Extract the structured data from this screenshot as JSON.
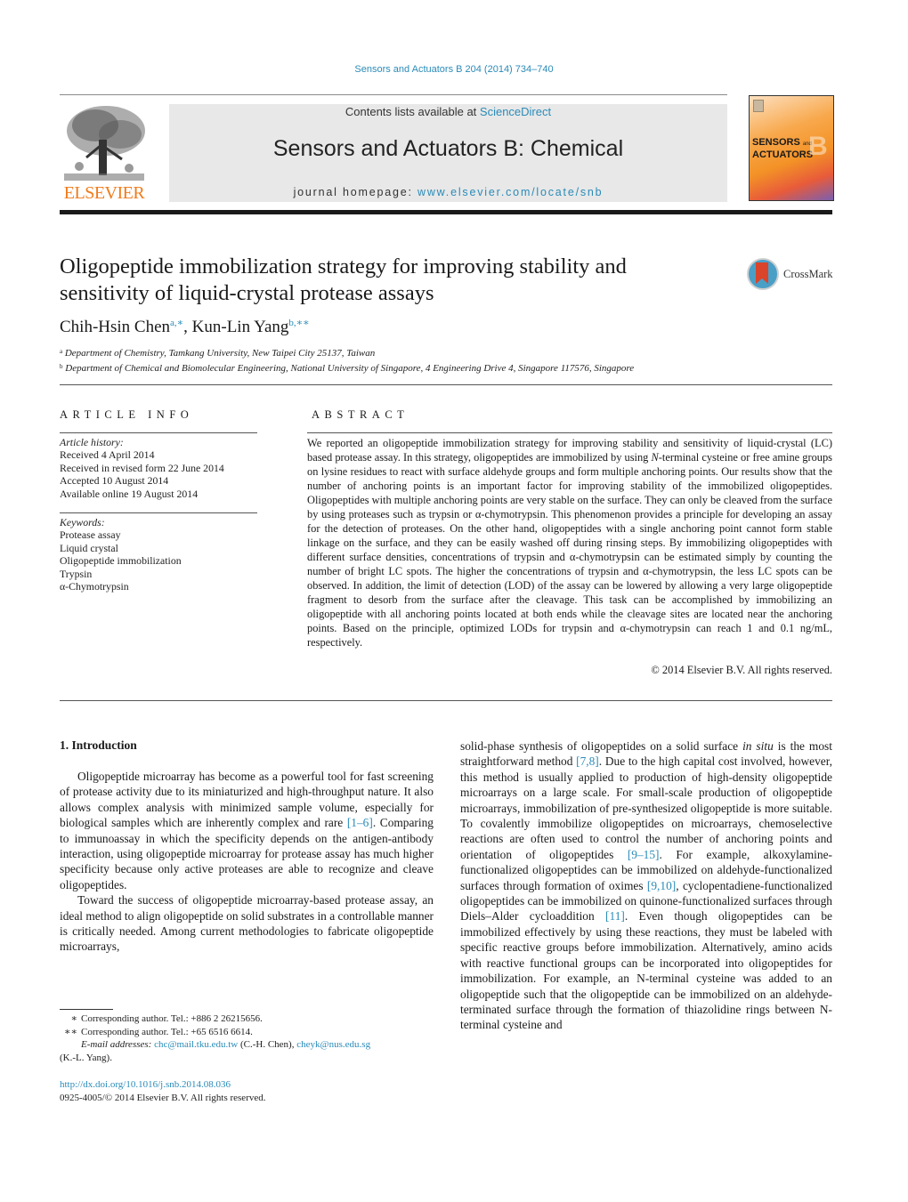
{
  "header": {
    "journal_ref": "Sensors and Actuators B 204 (2014) 734–740",
    "contents_prefix": "Contents lists available at ",
    "contents_link": "ScienceDirect",
    "journal_title": "Sensors and Actuators B: Chemical",
    "homepage_prefix": "journal homepage: ",
    "homepage_link": "www.elsevier.com/locate/snb",
    "publisher_logo_text": "ELSEVIER",
    "cover": {
      "title_line1": "SENSORS",
      "title_and": "and",
      "title_line2": "ACTUATORS",
      "letter": "B"
    },
    "colors": {
      "link": "#2a8bb8",
      "elsevier_orange": "#f07b1a"
    }
  },
  "article": {
    "title": "Oligopeptide immobilization strategy for improving stability and sensitivity of liquid-crystal protease assays",
    "crossmark_label": "CrossMark",
    "authors": [
      {
        "name": "Chih-Hsin Chen",
        "sup": "a,∗"
      },
      {
        "name": "Kun-Lin Yang",
        "sup": "b,∗∗"
      }
    ],
    "author_separator": ", ",
    "affiliations": [
      {
        "mark": "a",
        "text": "Department of Chemistry, Tamkang University, New Taipei City 25137, Taiwan"
      },
      {
        "mark": "b",
        "text": "Department of Chemical and Biomolecular Engineering, National University of Singapore, 4 Engineering Drive 4, Singapore 117576, Singapore"
      }
    ]
  },
  "article_info": {
    "heading": "ARTICLE INFO",
    "history_label": "Article history:",
    "history": [
      "Received 4 April 2014",
      "Received in revised form 22 June 2014",
      "Accepted 10 August 2014",
      "Available online 19 August 2014"
    ],
    "keywords_label": "Keywords:",
    "keywords": [
      "Protease assay",
      "Liquid crystal",
      "Oligopeptide immobilization",
      "Trypsin",
      "α-Chymotrypsin"
    ]
  },
  "abstract": {
    "heading": "ABSTRACT",
    "text_part1": "We reported an oligopeptide immobilization strategy for improving stability and sensitivity of liquid-crystal (LC) based protease assay. In this strategy, oligopeptides are immobilized by using ",
    "text_italic": "N",
    "text_part2": "-terminal cysteine or free amine groups on lysine residues to react with surface aldehyde groups and form multiple anchoring points. Our results show that the number of anchoring points is an important factor for improving stability of the immobilized oligopeptides. Oligopeptides with multiple anchoring points are very stable on the surface. They can only be cleaved from the surface by using proteases such as trypsin or α-chymotrypsin. This phenomenon provides a principle for developing an assay for the detection of proteases. On the other hand, oligopeptides with a single anchoring point cannot form stable linkage on the surface, and they can be easily washed off during rinsing steps. By immobilizing oligopeptides with different surface densities, concentrations of trypsin and α-chymotrypsin can be estimated simply by counting the number of bright LC spots. The higher the concentrations of trypsin and α-chymotrypsin, the less LC spots can be observed. In addition, the limit of detection (LOD) of the assay can be lowered by allowing a very large oligopeptide fragment to desorb from the surface after the cleavage. This task can be accomplished by immobilizing an oligopeptide with all anchoring points located at both ends while the cleavage sites are located near the anchoring points. Based on the principle, optimized LODs for trypsin and α-chymotrypsin can reach 1 and 0.1 ng/mL, respectively.",
    "copyright": "© 2014 Elsevier B.V. All rights reserved."
  },
  "introduction": {
    "heading": "1.  Introduction",
    "left_p1_a": "Oligopeptide microarray has become as a powerful tool for fast screening of protease activity due to its miniaturized and high-throughput nature. It also allows complex analysis with minimized sample volume, especially for biological samples which are inherently complex and rare ",
    "left_p1_ref": "[1–6]",
    "left_p1_b": ". Comparing to immunoassay in which the specificity depends on the antigen-antibody interaction, using oligopeptide microarray for protease assay has much higher specificity because only active proteases are able to recognize and cleave oligopeptides.",
    "left_p2": "Toward the success of oligopeptide microarray-based protease assay, an ideal method to align oligopeptide on solid substrates in a controllable manner is critically needed. Among current methodologies to fabricate oligopeptide microarrays,",
    "right_a": "solid-phase synthesis of oligopeptides on a solid surface ",
    "right_italic": "in situ",
    "right_b": " is the most straightforward method ",
    "right_ref1": "[7,8]",
    "right_c": ". Due to the high capital cost involved, however, this method is usually applied to production of high-density oligopeptide microarrays on a large scale. For small-scale production of oligopeptide microarrays, immobilization of pre-synthesized oligopeptide is more suitable. To covalently immobilize oligopeptides on microarrays, chemoselective reactions are often used to control the number of anchoring points and orientation of oligopeptides ",
    "right_ref2": "[9–15]",
    "right_d": ". For example, alkoxylamine-functionalized oligopeptides can be immobilized on aldehyde-functionalized surfaces through formation of oximes ",
    "right_ref3": "[9,10]",
    "right_e": ", cyclopentadiene-functionalized oligopeptides can be immobilized on quinone-functionalized surfaces through Diels–Alder cycloaddition ",
    "right_ref4": "[11]",
    "right_f": ". Even though oligopeptides can be immobilized effectively by using these reactions, they must be labeled with specific reactive groups before immobilization. Alternatively, amino acids with reactive functional groups can be incorporated into oligopeptides for immobilization. For example, an N-terminal cysteine was added to an oligopeptide such that the oligopeptide can be immobilized on an aldehyde-terminated surface through the formation of thiazolidine rings between N-terminal cysteine and"
  },
  "footnotes": {
    "items": [
      {
        "mark": "∗",
        "text": "Corresponding author. Tel.: +886 2 26215656."
      },
      {
        "mark": "∗∗",
        "text": "Corresponding author. Tel.: +65 6516 6614."
      }
    ],
    "email_label": "E-mail addresses:",
    "email1": "chc@mail.tku.edu.tw",
    "email1_owner": " (C.-H. Chen), ",
    "email2": "cheyk@nus.edu.sg",
    "email2_owner": "(K.-L. Yang).",
    "doi": "http://dx.doi.org/10.1016/j.snb.2014.08.036",
    "issn_copyright": "0925-4005/© 2014 Elsevier B.V. All rights reserved."
  }
}
